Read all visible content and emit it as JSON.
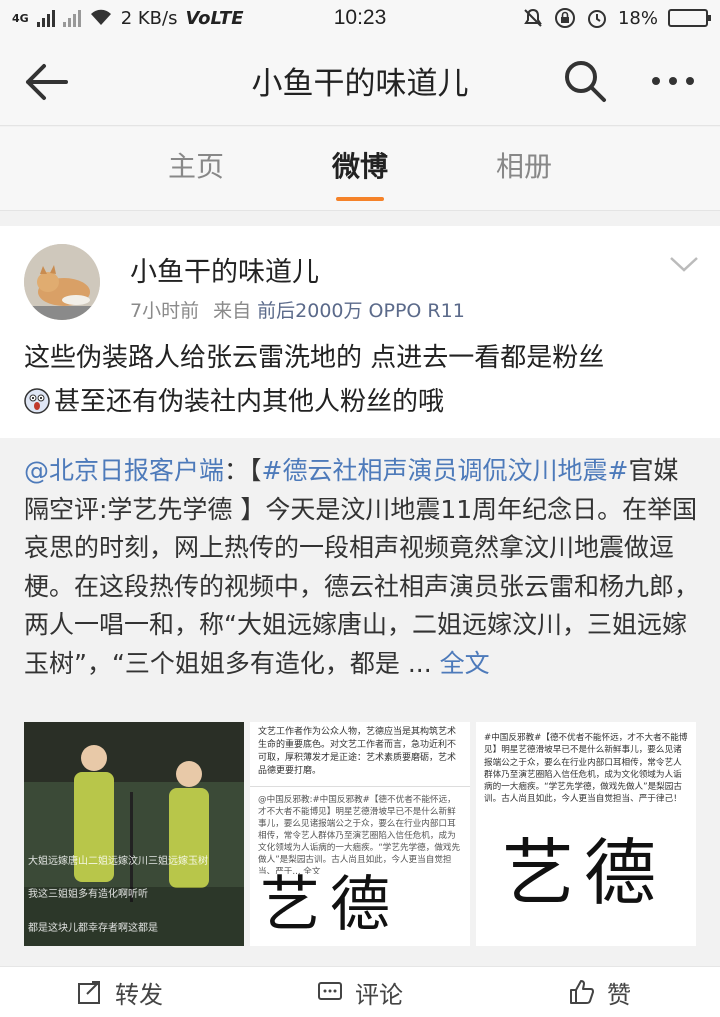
{
  "statusbar": {
    "net": "4G",
    "speed": "2 KB/s",
    "volte": "VoLTE",
    "time": "10:23",
    "battery": "18%",
    "battery_level": 0.18
  },
  "nav": {
    "title": "小鱼干的味道儿"
  },
  "tabs": [
    {
      "label": "主页"
    },
    {
      "label": "微博"
    },
    {
      "label": "相册"
    }
  ],
  "post": {
    "author": "小鱼干的味道儿",
    "time": "7小时前",
    "from": "来自",
    "source": "前后2000万 OPPO R11",
    "text_line1": "这些伪装路人给张云雷洗地的 点进去一看都是粉丝",
    "text_line2": "甚至还有伪装社内其他人粉丝的哦"
  },
  "repost": {
    "mention": "@北京日报客户端",
    "colon": "：",
    "bracket_open": "【",
    "hashtag": "#德云社相声演员调侃汶川地震#",
    "body": "官媒隔空评:学艺先学德 】今天是汶川地震11周年纪念日。在举国哀思的时刻，网上热传的一段相声视频竟然拿汶川地震做逗梗。在这段热传的视频中，德云社相声演员张云雷和杨九郎，两人一唱一和，称“大姐远嫁唐山，二姐远嫁汶川，三姐远嫁玉树”，“三个姐姐多有造化，都是 ... ",
    "full_text": "全文"
  },
  "images": {
    "img1": {
      "caption1": "大姐远嫁唐山二姐远嫁汶川三姐远嫁玉树",
      "caption2": "我这三姐姐多有造化啊听听",
      "caption3": "都是这块儿都幸存者啊这都是"
    },
    "img2": {
      "text1": "文艺工作者作为公众人物，艺德应当是其构筑艺术生命的重要底色。对文艺工作者而言，急功近利不可取，厚积薄发才是正途：艺术素质要磨砺，艺术品德更要打磨。",
      "text2": "@中国反邪教:#中国反邪教#【德不优者不能怀远，才不大者不能博见】明星艺德滑坡早已不是什么新鲜事儿，要么见诸报端公之于众，要么在行业内部口耳相传，常令艺人群体乃至演艺圈陷入信任危机，成为文化领域为人诟病的一大痼疾。“学艺先学德，做戏先做人”是梨园古训。古人尚且如此，今人更当自觉担当、严于... 全文",
      "art": "艺德"
    },
    "img3": {
      "text1": "#中国反邪教#【德不优者不能怀远，才不大者不能博见】明星艺德滑坡早已不是什么新鲜事儿，要么见诸报端公之于众，要么在行业内部口耳相传，常令艺人群体乃至演艺圈陷入信任危机，成为文化领域为人诟病的一大痼疾。“学艺先学德，做戏先做人”是梨园古训。古人尚且如此，今人更当自觉担当、严于律己！",
      "art": "艺德"
    }
  },
  "actions": {
    "repost": "转发",
    "comment": "评论",
    "like": "赞"
  },
  "colors": {
    "accent": "#f58229",
    "link": "#4d7aba"
  }
}
